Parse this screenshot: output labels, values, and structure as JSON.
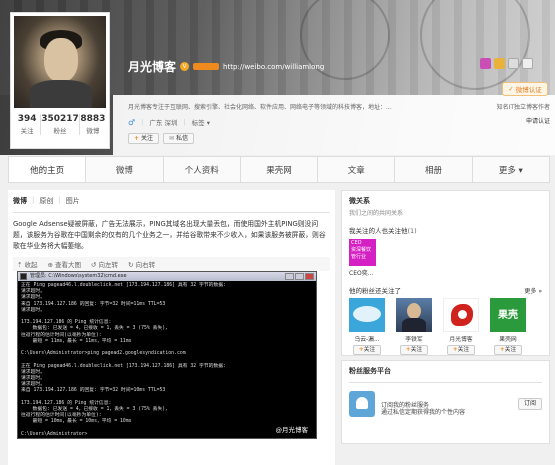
{
  "profile": {
    "name": "月光博客",
    "url": "http://weibo.com/williamlong",
    "description": "月光博客专注于互联网、搜索引擎、社会化网络、软件应用、网络电子等领域的科技博客，地址：...",
    "location": "广东 深圳",
    "tags_label": "标签 ▾",
    "gender_icon": "male-icon",
    "follow_label": "关注",
    "message_label": "私信"
  },
  "stats": [
    {
      "num": "394",
      "label": "关注"
    },
    {
      "num": "350217",
      "label": "粉丝"
    },
    {
      "num": "8883",
      "label": "微博"
    }
  ],
  "cert": {
    "badge": "微博认证",
    "text": "知名IT独立博客作者",
    "link": "申请认证"
  },
  "nav": [
    "他的主页",
    "微博",
    "个人资料",
    "果壳网",
    "文章",
    "相册",
    "更多 ▾"
  ],
  "subtabs": [
    "微博",
    "原创",
    "图片"
  ],
  "post": {
    "text": "Google Adsense疑被屏蔽，广告无法展示，PING其域名出现大量丢包，而使用国外主机PING则没问题，该服务为谷歌在中国剩余的仅有的几个业务之一，并给谷歌带来不少收入，如果该服务被屏蔽，则谷歌在华业务将大幅萎缩。",
    "toolbar": [
      "收起",
      "查看大图",
      "向左转",
      "向右转"
    ],
    "cmd_title": "管理员: C:\\Windows\\system32\\cmd.exe",
    "cmd_lines": [
      "正在 Ping pagead46.l.doubleclick.net [173.194.127.186] 具有 32 字节的数据:",
      "请求超时。",
      "请求超时。",
      "来自 173.194.127.186 的回复: 字节=32 时间=11ms TTL=53",
      "请求超时。",
      "",
      "173.194.127.186 的 Ping 统计信息:",
      "    数据包: 已发送 = 4，已接收 = 1，丢失 = 3 (75% 丢失)，",
      "往返行程的估计时间(以毫秒为单位):",
      "    最短 = 11ms，最长 = 11ms，平均 = 11ms",
      "",
      "C:\\Users\\Administrator>ping pagead2.googlesyndication.com",
      "",
      "正在 Ping pagead46.l.doubleclick.net [173.194.127.186] 具有 32 字节的数据:",
      "请求超时。",
      "请求超时。",
      "请求超时。",
      "来自 173.194.127.186 的回复: 字节=32 时间=10ms TTL=53",
      "",
      "173.194.127.186 的 Ping 统计信息:",
      "    数据包: 已发送 = 4，已接收 = 1，丢失 = 3 (75% 丢失)，",
      "往返行程的估计时间(以毫秒为单位):",
      "    最短 = 10ms，最长 = 10ms，平均 = 10ms",
      "",
      "C:\\Users\\Administrator>"
    ],
    "watermark": "@月光博客"
  },
  "side": {
    "weiguanxi_title": "微关系",
    "weiguanxi_sub": "我们之间的共同关系",
    "followed_heading": "我关注的人也关注他",
    "followed_count": "(1)",
    "ceo_tile": "CEO\n资深餐饮\n管行业",
    "ceo_name": "CEO奕...",
    "fans_heading": "他的粉丝还关注了",
    "more": "更多 »",
    "fans": [
      {
        "name": "乌云-漏...",
        "icon": "wooyun-icon"
      },
      {
        "name": "李铁军",
        "icon": "person-photo"
      },
      {
        "name": "月光博客",
        "icon": "lion-icon"
      },
      {
        "name": "果壳网",
        "icon": "guokr-icon"
      }
    ],
    "fan_follow": "关注",
    "panel_title": "粉丝服务平台",
    "sub_text": "订阅我的粉丝服务",
    "sub_btn": "订阅",
    "sub_text2": "通过私信定期获得我的个性内容"
  },
  "colors": {
    "accent": "#ee8a1e",
    "link": "#0a6ba8",
    "ceo_tile": "#d420c2"
  }
}
